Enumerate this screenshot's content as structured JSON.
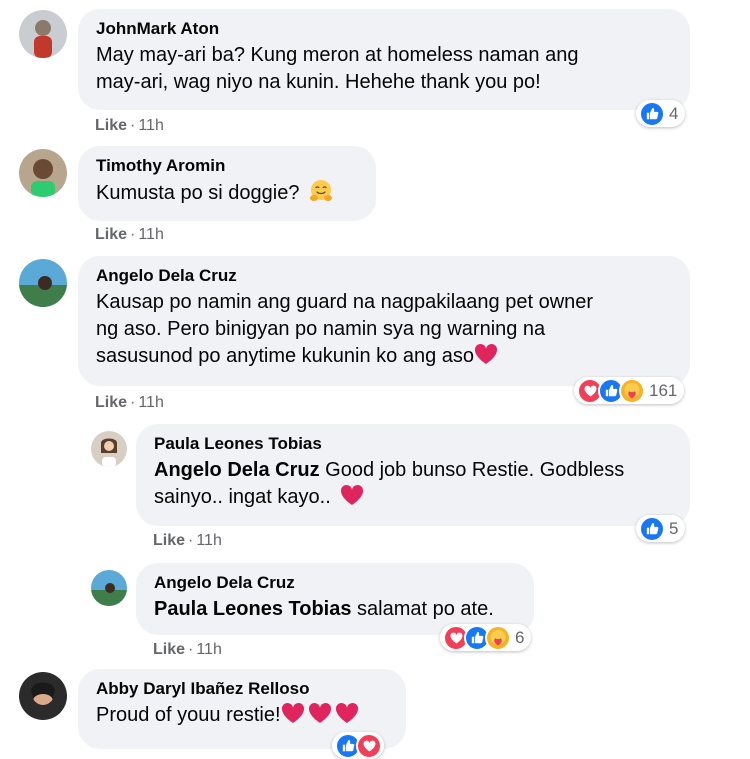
{
  "comments": [
    {
      "author": "JohnMark Aton",
      "text": "May may-ari ba? Kung meron at homeless naman ang may-ari, wag niyo na kunin. Hehehe thank you po!",
      "line1": "May may-ari ba? Kung meron at homeless naman ang",
      "line2": "may-ari, wag niyo na kunin. Hehehe thank you po!",
      "like": "Like",
      "time": "11h",
      "reaction_count": "4",
      "reactions": [
        "like"
      ]
    },
    {
      "author": "Timothy Aromin",
      "text": "Kumusta po si doggie?",
      "emoji": "hugging-face",
      "like": "Like",
      "time": "11h"
    },
    {
      "author": "Angelo Dela Cruz",
      "line1": "Kausap po namin ang guard na nagpakilaang pet owner",
      "line2": "ng aso. Pero binigyan po namin sya ng warning na",
      "line3": "sasusunod po anytime kukunin ko ang aso",
      "emoji": "red-heart",
      "like": "Like",
      "time": "11h",
      "reaction_count": "161",
      "reactions": [
        "love",
        "like",
        "care"
      ],
      "replies": [
        {
          "author": "Paula Leones Tobias",
          "mention": "Angelo Dela Cruz",
          "line1": " Good job bunso Restie. Godbless",
          "line2": "sainyo.. ingat kayo..",
          "emoji": "red-heart",
          "like": "Like",
          "time": "11h",
          "reaction_count": "5",
          "reactions": [
            "like"
          ]
        },
        {
          "author": "Angelo Dela Cruz",
          "mention": "Paula Leones Tobias",
          "line1": " salamat po ate.",
          "like": "Like",
          "time": "11h",
          "reaction_count": "6",
          "reactions": [
            "love",
            "like",
            "care"
          ]
        }
      ]
    },
    {
      "author": "Abby Daryl Ibañez Relloso",
      "text": "Proud of youu restie!",
      "emoji": "red-heart x3",
      "reactions": [
        "like",
        "love"
      ]
    }
  ],
  "colors": {
    "bubble": "#f0f2f5",
    "meta": "#65676b",
    "like_blue": "#1877f2",
    "love_red": "#f33e58",
    "care_yellow": "#f7b125",
    "heart_red": "#e0245e"
  }
}
